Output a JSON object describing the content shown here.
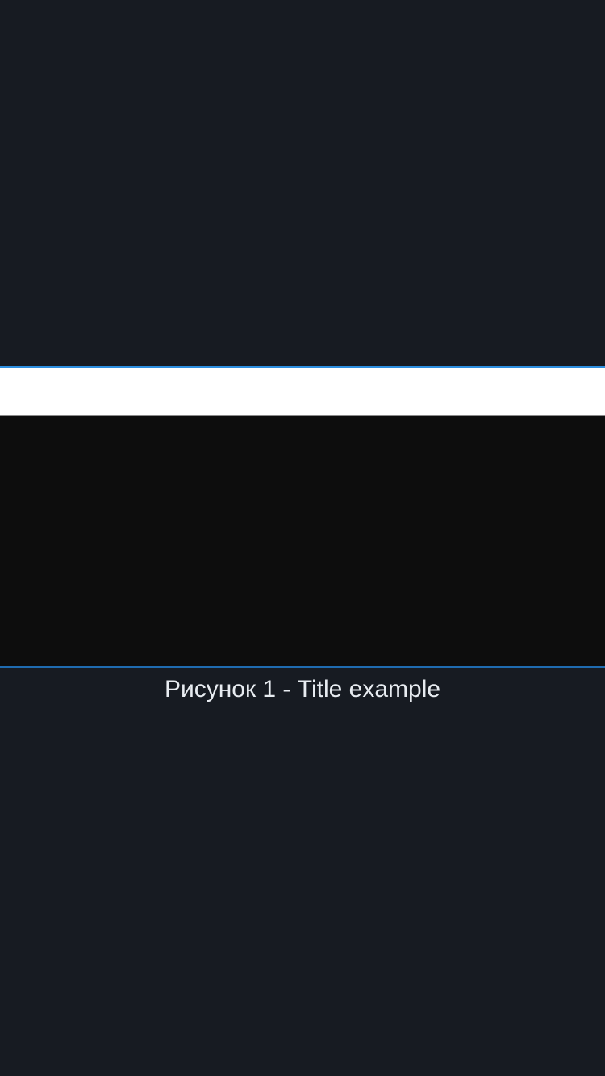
{
  "figure": {
    "caption": "Рисунок 1 - Title example"
  },
  "colors": {
    "background": "#171b22",
    "accent": "#2d8fe0",
    "figure_band": "#ffffff",
    "figure_body": "#0d0d0d",
    "caption_text": "#e8ecf1"
  }
}
